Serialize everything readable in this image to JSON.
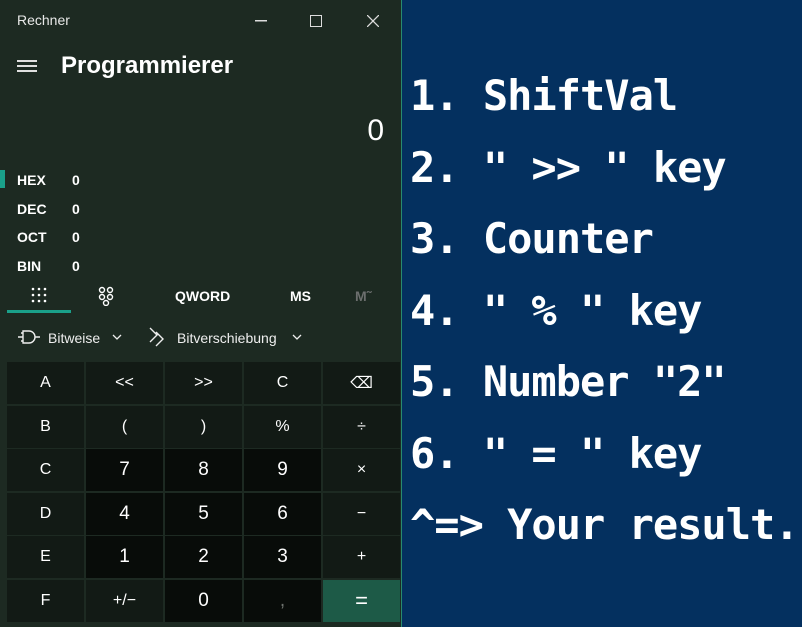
{
  "window": {
    "title": "Rechner"
  },
  "header": {
    "mode": "Programmierer"
  },
  "display": {
    "value": "0"
  },
  "bases": [
    {
      "label": "HEX",
      "value": "0"
    },
    {
      "label": "DEC",
      "value": "0"
    },
    {
      "label": "OCT",
      "value": "0"
    },
    {
      "label": "BIN",
      "value": "0"
    }
  ],
  "toolbar": {
    "word_size": "QWORD",
    "ms": "MS",
    "m_dropdown": "M˜"
  },
  "bit_row": {
    "bitwise": "Bitweise",
    "bitshift": "Bitverschiebung"
  },
  "keys": [
    [
      "A",
      "<<",
      ">>",
      "C",
      "⌫"
    ],
    [
      "B",
      "(",
      ")",
      "%",
      "÷"
    ],
    [
      "C",
      "7",
      "8",
      "9",
      "×"
    ],
    [
      "D",
      "4",
      "5",
      "6",
      "−"
    ],
    [
      "E",
      "1",
      "2",
      "3",
      "+"
    ],
    [
      "F",
      "+/−",
      "0",
      ",",
      "="
    ]
  ],
  "instructions": [
    "1. ShiftVal",
    "2. \" >> \" key",
    "3. Counter",
    "4. \" % \" key",
    "5. Number \"2\"",
    "6. \" = \" key",
    "^=> Your result."
  ],
  "colors": {
    "accent": "#1aa08a",
    "background_right": "#04305f",
    "calc_bg": "#1d2a22"
  }
}
